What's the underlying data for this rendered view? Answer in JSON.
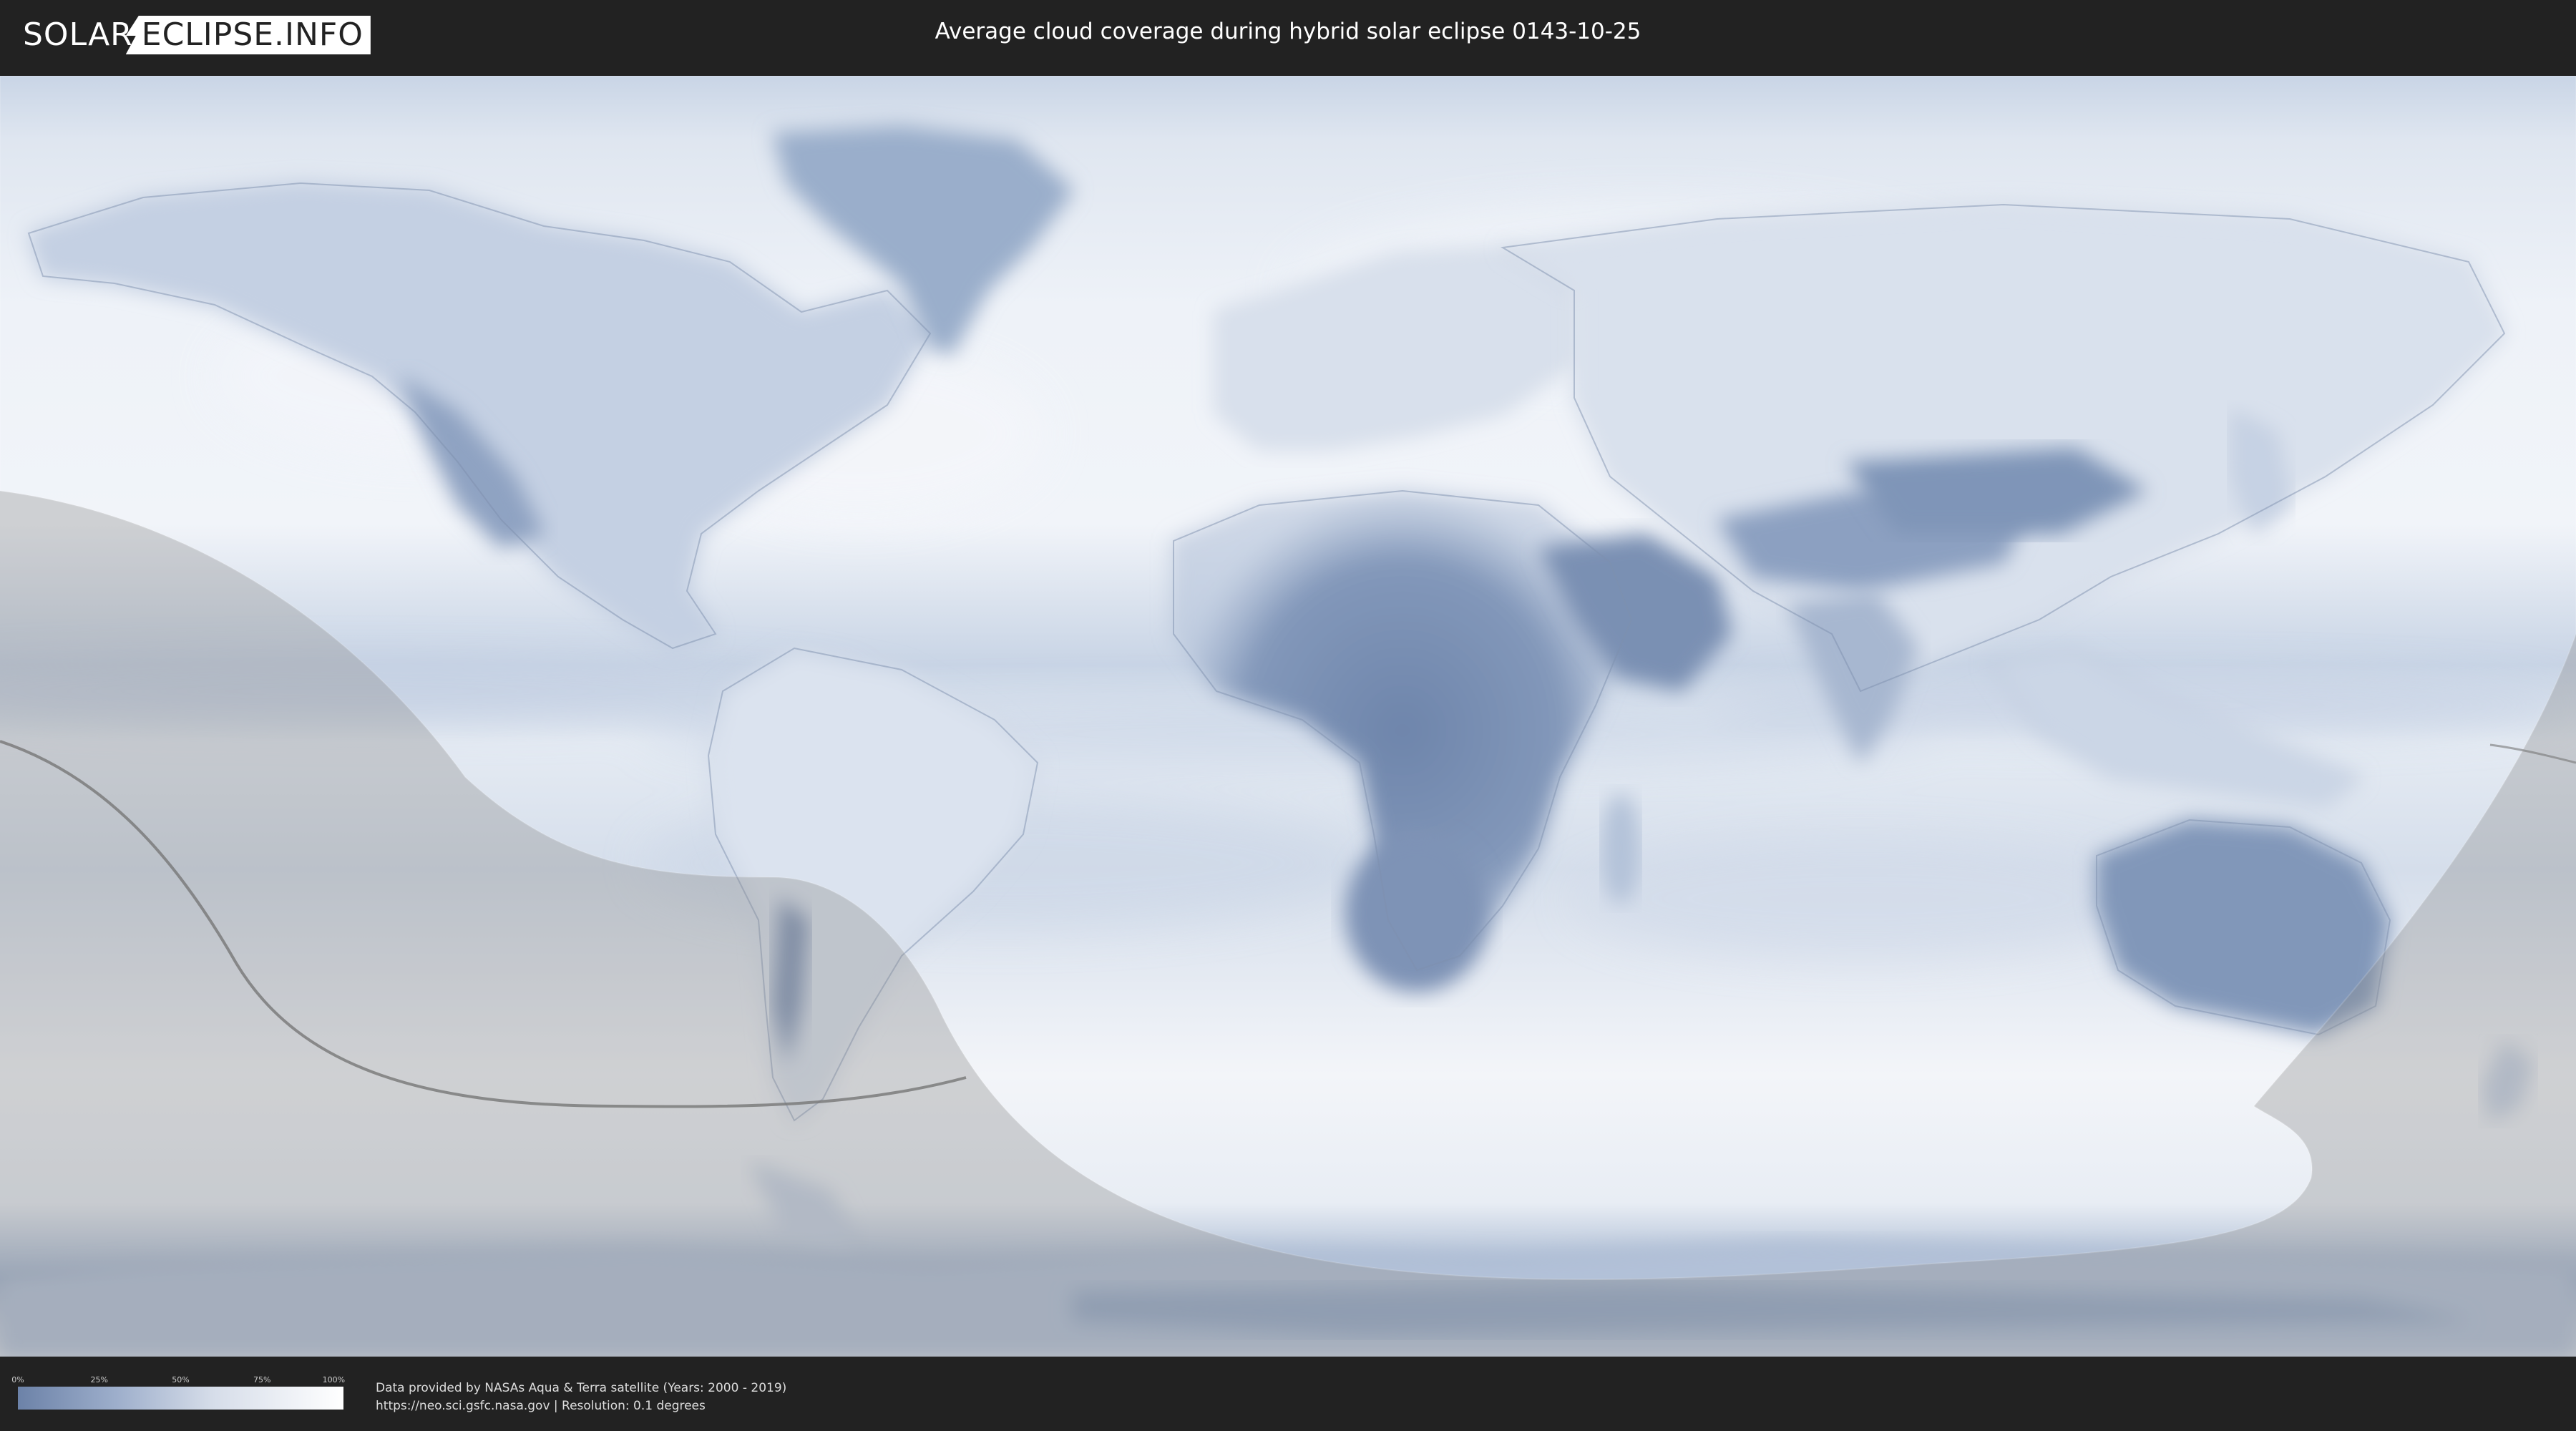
{
  "header": {
    "logo_left": "SOLAR",
    "logo_right": "ECLIPSE.INFO",
    "title": "Average cloud coverage during hybrid solar eclipse 0143-10-25"
  },
  "map": {
    "colors": {
      "ocean_cloud": "#e9eef6",
      "clear_sky": "#6f86ac",
      "medium": "#a9b9d3",
      "coastline": "#8a9ab5",
      "shadow": "#9a9a9a",
      "eclipse_path": "#777777"
    },
    "icons": [
      "world-map-cloud-coverage",
      "eclipse-visibility-shading",
      "eclipse-path-line"
    ]
  },
  "legend": {
    "ticks": [
      "0%",
      "25%",
      "50%",
      "75%",
      "100%"
    ]
  },
  "credits": {
    "line1": "Data provided by NASAs Aqua & Terra satellite (Years: 2000 - 2019)",
    "line2": "https://neo.sci.gsfc.nasa.gov | Resolution: 0.1 degrees"
  }
}
